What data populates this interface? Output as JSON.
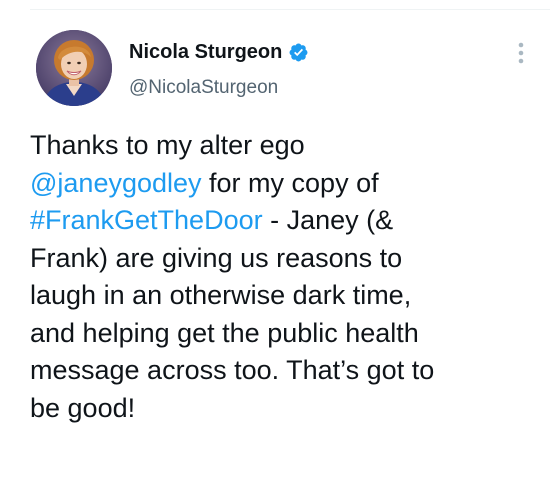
{
  "author": {
    "display_name": "Nicola Sturgeon",
    "handle": "@NicolaSturgeon",
    "verified": true,
    "verified_icon": "verified-badge-icon",
    "accent_color": "#1d9bf0"
  },
  "menu": {
    "icon": "more-options-icon"
  },
  "tweet": {
    "lines": [
      [
        {
          "text": "Thanks to my alter ego",
          "type": "text"
        }
      ],
      [
        {
          "text": "@janeygodley",
          "type": "mention"
        },
        {
          "text": " for my copy of",
          "type": "text"
        }
      ],
      [
        {
          "text": "#FrankGetTheDoor",
          "type": "hashtag"
        },
        {
          "text": " - Janey (&",
          "type": "text"
        }
      ],
      [
        {
          "text": "Frank) are giving us reasons to",
          "type": "text"
        }
      ],
      [
        {
          "text": "laugh in an otherwise dark time,",
          "type": "text"
        }
      ],
      [
        {
          "text": "and helping get the public health",
          "type": "text"
        }
      ],
      [
        {
          "text": "message across too. That’s got to",
          "type": "text"
        }
      ],
      [
        {
          "text": "be good!",
          "type": "text"
        }
      ]
    ]
  }
}
